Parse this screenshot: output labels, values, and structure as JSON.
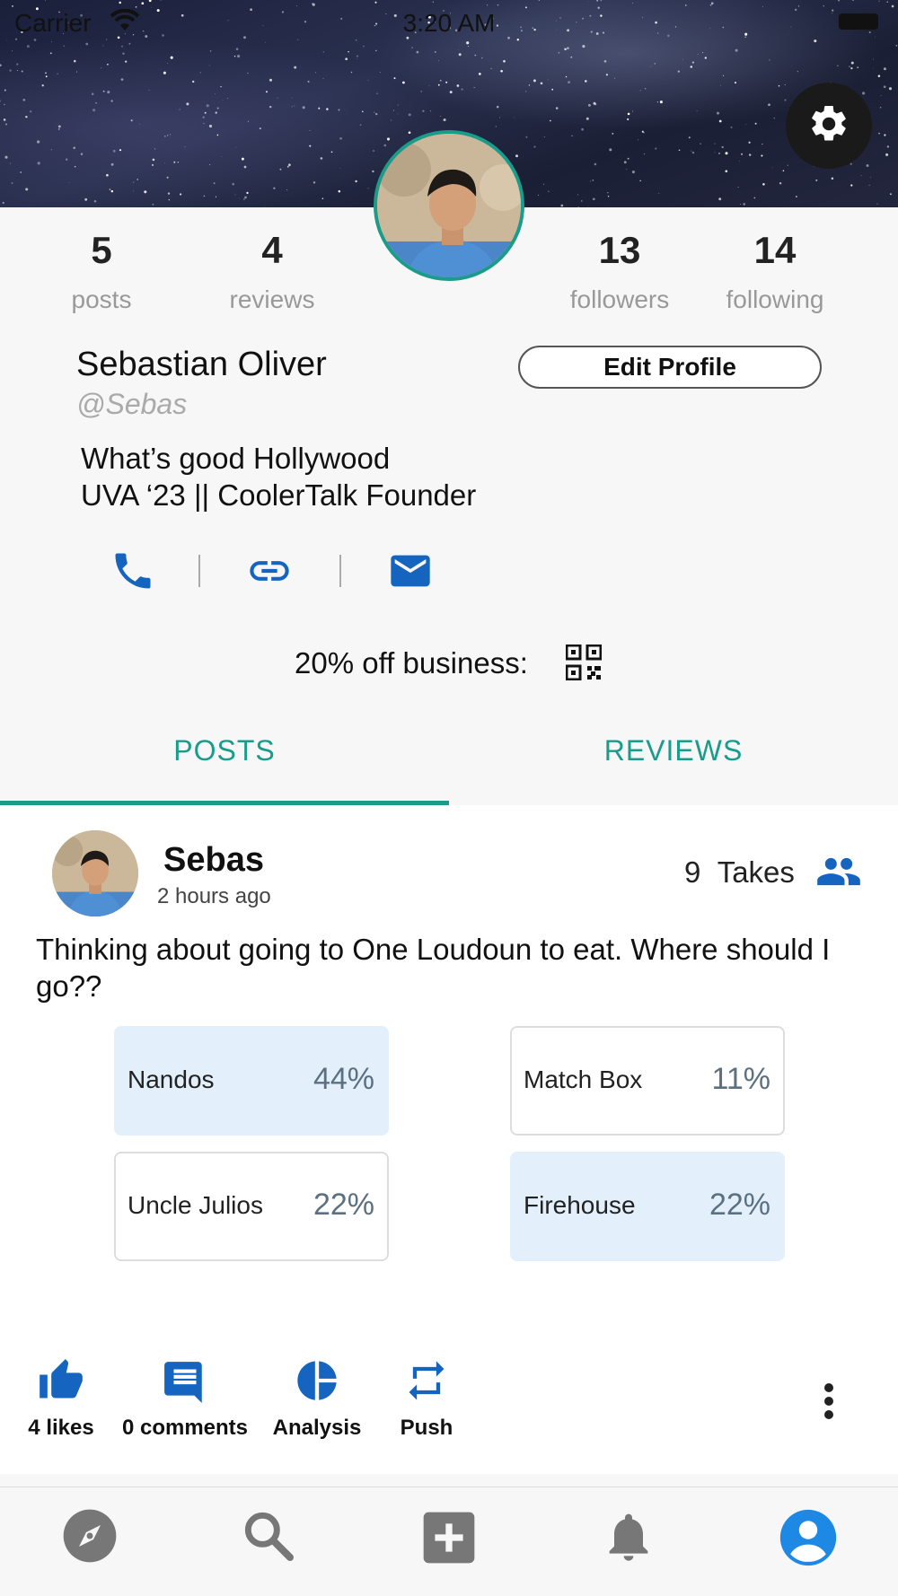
{
  "status_bar": {
    "carrier": "Carrier",
    "time": "3:20 AM"
  },
  "profile": {
    "name": "Sebastian Oliver",
    "handle": "@Sebas",
    "bio_line1": "What’s good Hollywood",
    "bio_line2": "UVA ‘23 ||  CoolerTalk Founder",
    "edit_label": "Edit Profile",
    "promo": "20% off business:",
    "stats": [
      {
        "num": "5",
        "label": "posts"
      },
      {
        "num": "4",
        "label": "reviews"
      },
      {
        "num": "13",
        "label": "followers"
      },
      {
        "num": "14",
        "label": "following"
      }
    ]
  },
  "tabs": [
    {
      "label": "POSTS"
    },
    {
      "label": "REVIEWS"
    }
  ],
  "post": {
    "user": "Sebas",
    "time": "2 hours ago",
    "takes_count": "9",
    "takes_label": "Takes",
    "text": "Thinking about going to One Loudoun to eat. Where should I go??",
    "options": [
      {
        "label": "Nandos",
        "pct": "44%"
      },
      {
        "label": "Match Box",
        "pct": "11%"
      },
      {
        "label": "Uncle Julios",
        "pct": "22%"
      },
      {
        "label": "Firehouse",
        "pct": "22%"
      }
    ],
    "actions": [
      {
        "label": "4 likes"
      },
      {
        "label": "0 comments"
      },
      {
        "label": "Analysis"
      },
      {
        "label": "Push"
      }
    ]
  },
  "colors": {
    "accent": "#1a9c8a",
    "icon_blue": "#1565c0",
    "lead_fill": "#e3f0fc"
  },
  "icons": [
    "wifi-icon",
    "battery-icon",
    "gear-icon",
    "phone-icon",
    "link-icon",
    "mail-icon",
    "qr-code-icon",
    "people-icon",
    "thumbs-up-icon",
    "comment-icon",
    "pie-chart-icon",
    "repeat-icon",
    "more-vertical-icon",
    "compass-icon",
    "search-icon",
    "add-box-icon",
    "bell-icon",
    "account-circle-icon"
  ]
}
